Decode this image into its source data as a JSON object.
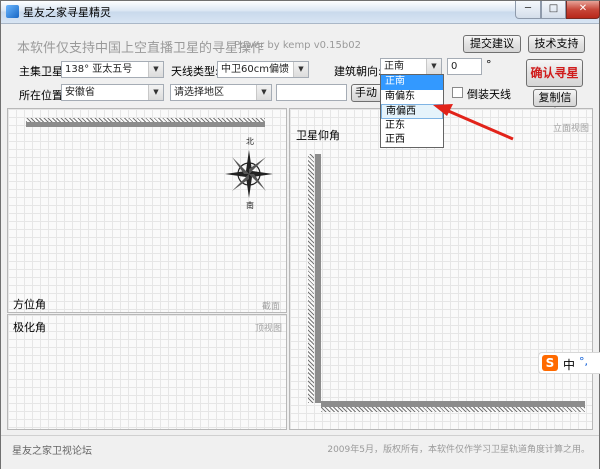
{
  "window": {
    "title": "星友之家寻星精灵",
    "min": "─",
    "max": "□",
    "close": "✕"
  },
  "header": {
    "banner": "本软件仅支持中国上空直播卫星的寻星操作",
    "power": "Power by kemp  v0.15b02",
    "submit_label": "提交建议",
    "support_label": "技术支持"
  },
  "form": {
    "satellite_label": "主集卫星:",
    "satellite_value": "138°  亚太五号",
    "antenna_label": "天线类型:",
    "antenna_value": "中卫60cm偏馈",
    "facing_label": "建筑朝向:",
    "facing_value": "正南",
    "angle_value": "0",
    "angle_unit": "°",
    "confirm_label": "确认寻星",
    "location_label": "所在位置:",
    "province_value": "安徽省",
    "region_value": "请选择地区",
    "manual_label": "手动输",
    "flip_label": "倒装天线",
    "copy_label": "复制信息"
  },
  "dropdown": {
    "options": [
      "正南",
      "南偏东",
      "南偏西",
      "正东",
      "正西"
    ],
    "selected_index": 0,
    "hover_index": 2
  },
  "panels": {
    "azimuth_label": "方位角",
    "section_tag": "截面",
    "polarization_label": "极化角",
    "top_view_tag": "顶视图",
    "elevation_label": "卫星仰角",
    "elevation_view_tag": "立面视图"
  },
  "compass": {
    "north": "北",
    "south": "南"
  },
  "status": {
    "left": "星友之家卫视论坛",
    "right": "2009年5月，版权所有，本软件仅作学习卫星轨道角度计算之用。"
  },
  "ime": {
    "logo": "S",
    "mode": "中",
    "punct": "°,"
  },
  "colors": {
    "accent_red": "#d01c1c",
    "selection_blue": "#3399ff",
    "arrow_red": "#e2231a"
  }
}
